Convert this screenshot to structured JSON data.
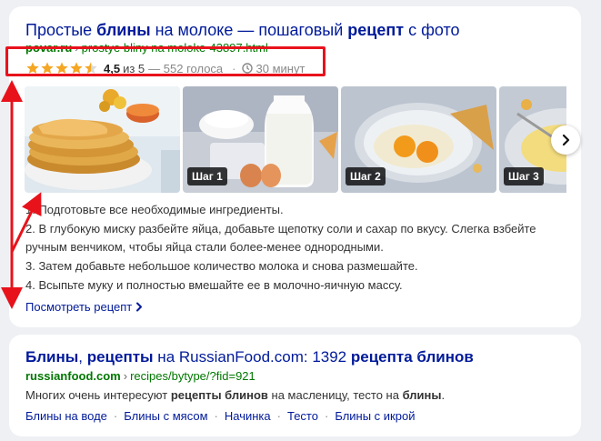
{
  "result1": {
    "title_parts": [
      "Простые ",
      "блины",
      " на молоке — пошаговый ",
      "рецепт",
      " с фото"
    ],
    "url_domain": "povar.ru",
    "url_separator": "›",
    "url_path": "prostye bliny na moloke-43897.html",
    "rating": {
      "stars_value": 4.5,
      "stars_max": 5,
      "score": "4,5",
      "of_max": "из 5",
      "votes": "— 552 голоса",
      "separator": "·",
      "time": "30 минут"
    },
    "gallery": [
      {
        "step": "",
        "description_icon": "pancake-stack-photo"
      },
      {
        "step": "Шаг 1",
        "description_icon": "flour-milk-eggs-photo"
      },
      {
        "step": "Шаг 2",
        "description_icon": "eggs-in-bowl-photo"
      },
      {
        "step": "Шаг 3",
        "description_icon": "whisked-eggs-photo"
      }
    ],
    "next_icon": "chevron-right-icon",
    "steps": [
      "1. Подготовьте все необходимые ингредиенты.",
      "2. В глубокую миску разбейте яйца, добавьте щепотку соли и сахар по вкусу. Слегка взбейте ручным венчиком, чтобы яйца стали более-менее однородными.",
      "3. Затем добавьте небольшое количество молока и снова размешайте.",
      "4. Всыпьте муку и полностью вмешайте ее в молочно-яичную массу."
    ],
    "more_link": "Посмотреть рецепт"
  },
  "result2": {
    "title_parts": [
      "Блины",
      ", ",
      "рецепты",
      " на RussianFood.com: 1392 ",
      "рецепта блинов"
    ],
    "url_domain": "russianfood.com",
    "url_separator": "›",
    "url_path": "recipes/bytype/?fid=921",
    "snippet_parts": [
      "Многих очень интересуют ",
      "рецепты блинов",
      " на масленицу, тесто на ",
      "блины",
      "."
    ],
    "sitelinks": [
      "Блины на воде",
      "Блины с мясом",
      "Начинка",
      "Тесто",
      "Блины с икрой"
    ],
    "sitelink_separator": "·"
  },
  "colors": {
    "link": "#001a9a",
    "url_green": "#007700",
    "star": "#f5a623",
    "annotation_red": "#e8121b",
    "page_bg": "#eef0f4"
  }
}
